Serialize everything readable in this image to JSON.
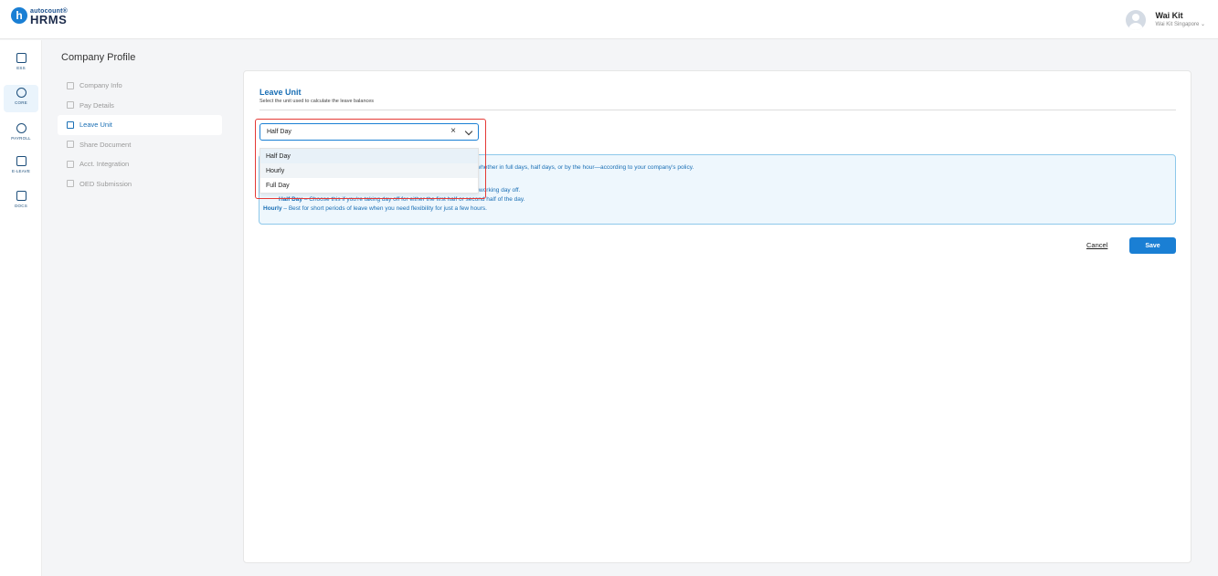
{
  "header": {
    "logo_small": "autocount®",
    "logo_big": "HRMS",
    "logo_letter": "h",
    "user_name": "Wai Kit",
    "user_company": "Wai Kit Singapore ⌄"
  },
  "rail": [
    {
      "label": "ESS",
      "icon": "ess-icon"
    },
    {
      "label": "CORE",
      "icon": "core-icon"
    },
    {
      "label": "PAYROLL",
      "icon": "payroll-icon"
    },
    {
      "label": "E-LEAVE",
      "icon": "e-leave-icon"
    },
    {
      "label": "DOCS",
      "icon": "docs-icon"
    }
  ],
  "page_title": "Company Profile",
  "nav": [
    {
      "label": "Company Info"
    },
    {
      "label": "Pay Details"
    },
    {
      "label": "Leave Unit"
    },
    {
      "label": "Share Document"
    },
    {
      "label": "Acct. Integration"
    },
    {
      "label": "OED Submission"
    }
  ],
  "section": {
    "title": "Leave Unit",
    "subtitle": "Select the unit used to calculate the leave balances"
  },
  "select": {
    "value": "Half Day",
    "clear": "×",
    "options": [
      "Half Day",
      "Hourly",
      "Full Day"
    ]
  },
  "info": {
    "line1": "—whether in full days, half days, or by the hour—according to your company's policy.",
    "line2": "working day off.",
    "line3_label": "Half Day",
    "line3_text": " – Choose this if you're taking day off for either the first half or second half of the day.",
    "line4_label": "Hourly",
    "line4_text": " – Best for short periods of leave when you need flexibility for just a few hours."
  },
  "actions": {
    "cancel": "Cancel",
    "save": "Save"
  },
  "colors": {
    "accent": "#1a7fd4",
    "highlight": "#e53935"
  }
}
